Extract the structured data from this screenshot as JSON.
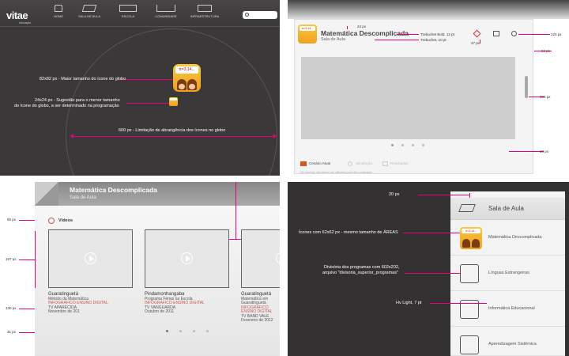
{
  "q1": {
    "brand": "vitae",
    "brand_sub": "educação",
    "nav": [
      "HOME",
      "SALA DE AULA",
      "ESCOLA",
      "COMUNIDADE",
      "INFRAESTRUTURA"
    ],
    "icon_formula": "π=3,14...",
    "ann_large": "82x82 px - Maior tamanho do ícone do globo",
    "ann_small_1": "24x24 px - Sugestão para o menor tamanho",
    "ann_small_2": "do ícone do globo, a ser determinado na programação",
    "ann_range": "600 px - Limitação de abrangência dos ícones no globo"
  },
  "q2": {
    "title": "Matemática Descomplicada",
    "subtitle": "Sala de Aula",
    "font_bold": "Trebuchet Bold, 12 pt",
    "font_regular": "Trebuchet, 10 pt",
    "measures": [
      "24 px",
      "47 px",
      "120 px",
      "24 px",
      "300 px",
      "20 px"
    ],
    "tabs": [
      "Cenário Atual",
      "Simulação",
      "Resultados"
    ],
    "footer_text": "Os recursos não devem ser utilizados para fins comerciais..."
  },
  "q3": {
    "title": "Matemática Descomplicada",
    "subtitle": "Sala de Aula",
    "section": "Vídeos",
    "measures": [
      "65 px",
      "197 px",
      "130 px",
      "31 px"
    ],
    "cards": [
      {
        "city": "Guaratinguetá",
        "line1": "Método da Matemática",
        "line2": "INFOGRÁFICO ENSINO DIGITAL",
        "line3": "TV APARECIDA",
        "line4": "Novembro de 201"
      },
      {
        "city": "Pindamonhangaba",
        "line1": "Programa Férias na Escola",
        "line2": "INFOGRÁFICO ENSINO DIGITAL",
        "line3": "TV VANGUARDA",
        "line4": "Outubro de 2011"
      },
      {
        "city": "Guaratinguetá",
        "line1": "Matemática em Guaratinguetá",
        "line2": "INFOGRÁFICO ENSINO DIGITAL",
        "line3": "TV BAND VALE",
        "line4": "Fevereiro de 2012"
      }
    ]
  },
  "q4": {
    "measure_top": "20 px",
    "header": "Sala de Aula",
    "ann_icons": "Ícones com 62x62 px - mesmo tamanho de ÁREAS",
    "ann_divider_1": "Divisória dos programas com 602x202,",
    "ann_divider_2": "arquivo \"divisoria_superior_programas\"",
    "ann_font": "Hv Light, 7 pt",
    "items": [
      "Matemática Descomplicada",
      "Línguas Estrangeiras",
      "Informática Educacional",
      "Aprendizagem Sistêmica"
    ],
    "icon_formula": "π=3,14..."
  },
  "colors": {
    "accent": "#e6007e",
    "dark": "#3a3838",
    "title_gray": "#777"
  }
}
